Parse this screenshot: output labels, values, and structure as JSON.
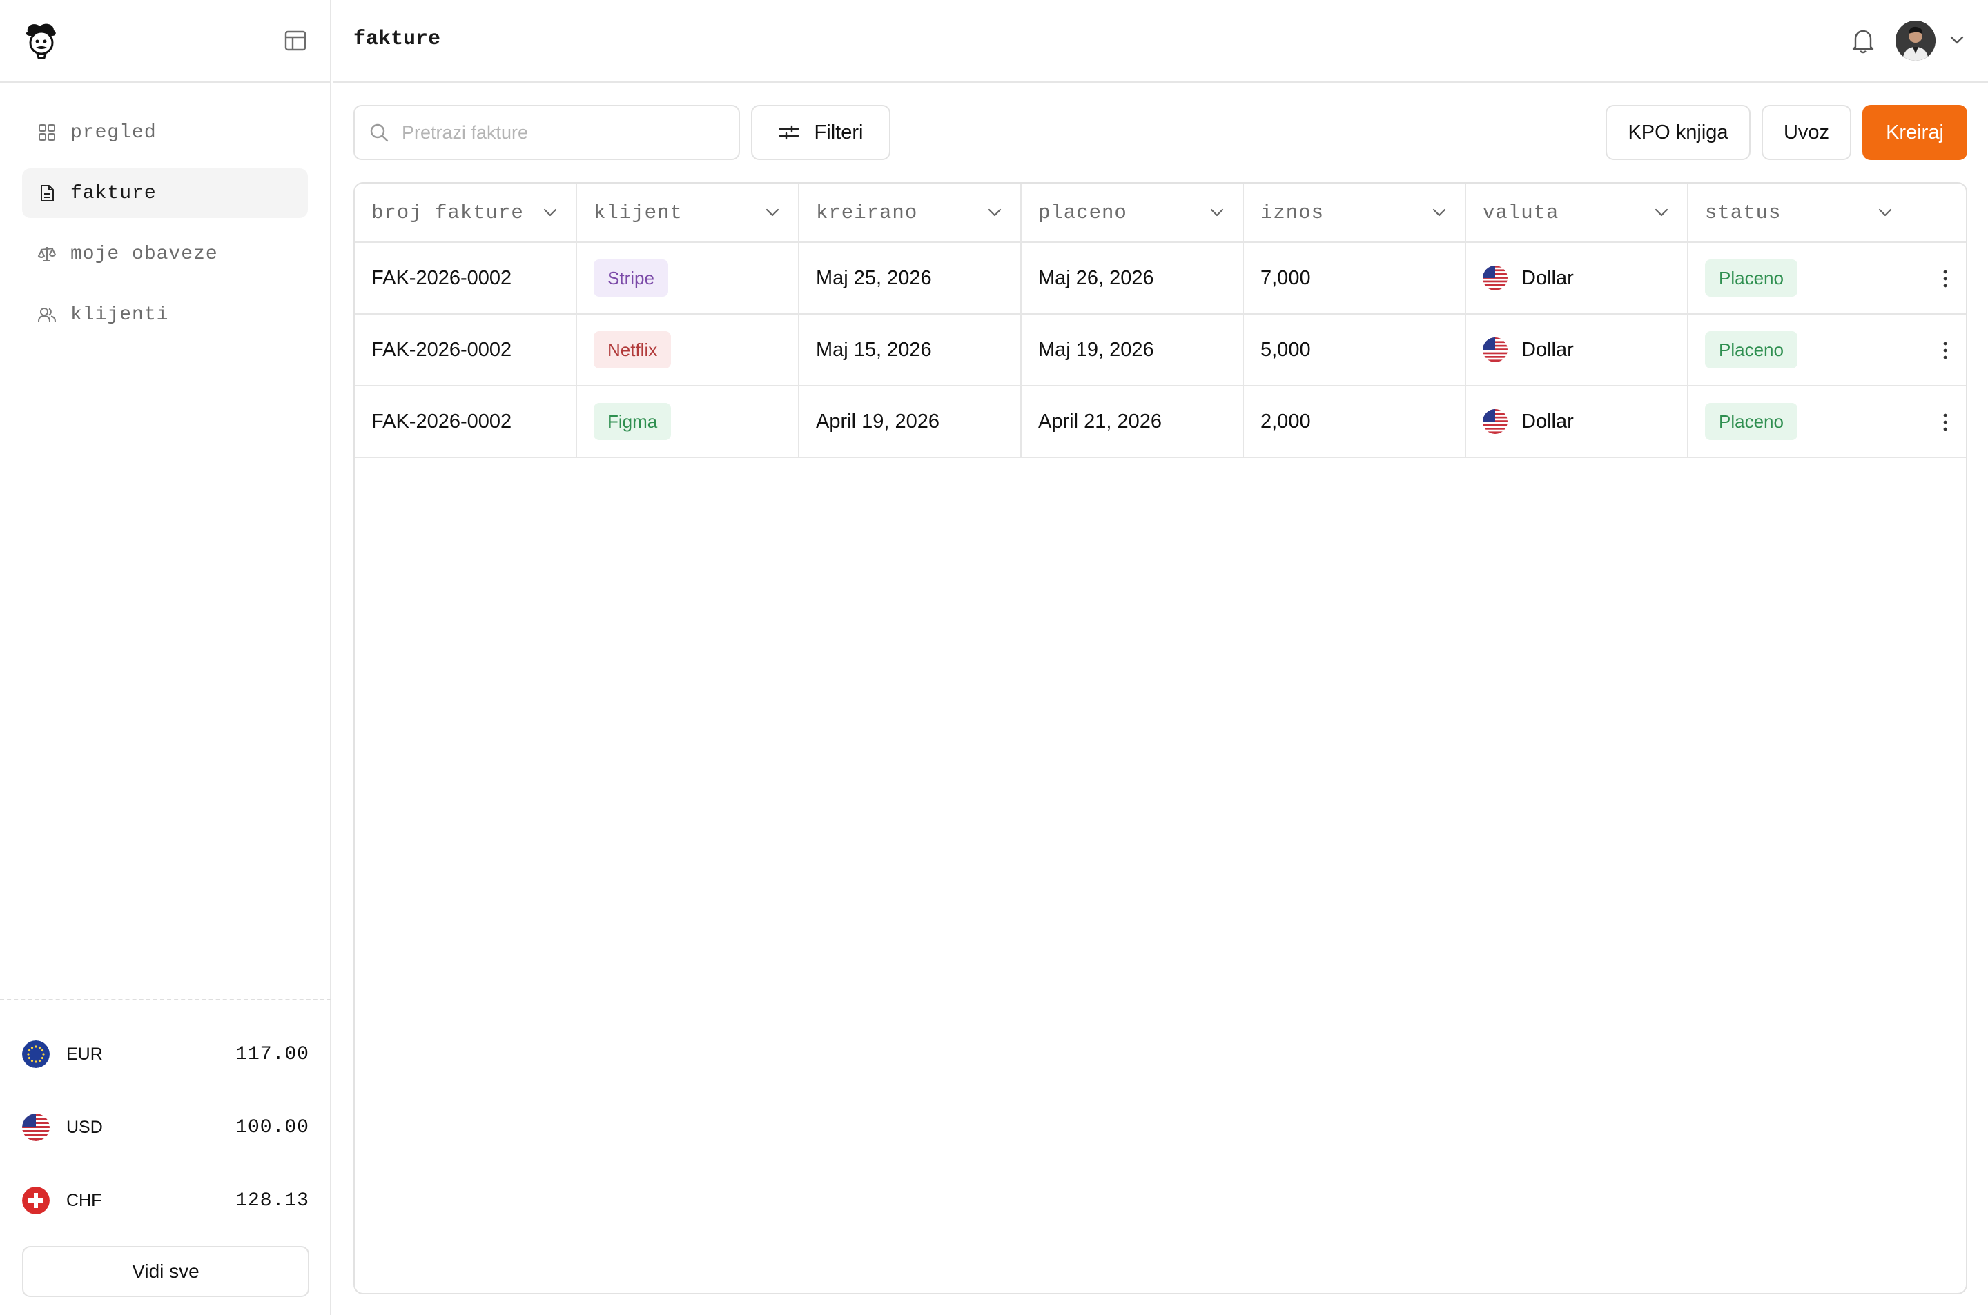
{
  "header": {
    "title": "fakture"
  },
  "sidebar": {
    "nav": [
      {
        "label": "pregled",
        "icon": "grid-icon"
      },
      {
        "label": "fakture",
        "icon": "document-icon",
        "active": true
      },
      {
        "label": "moje obaveze",
        "icon": "scale-icon"
      },
      {
        "label": "klijenti",
        "icon": "users-icon"
      }
    ],
    "balances": [
      {
        "code": "EUR",
        "amount": "117.00",
        "flag": "eu-flag-icon"
      },
      {
        "code": "USD",
        "amount": "100.00",
        "flag": "us-flag-icon"
      },
      {
        "code": "CHF",
        "amount": "128.13",
        "flag": "swiss-flag-icon"
      }
    ],
    "see_all": "Vidi sve"
  },
  "toolbar": {
    "search_placeholder": "Pretrazi fakture",
    "filters": "Filteri",
    "kpo": "KPO knjiga",
    "import": "Uvoz",
    "create": "Kreiraj"
  },
  "table": {
    "columns": [
      "broj fakture",
      "klijent",
      "kreirano",
      "placeno",
      "iznos",
      "valuta",
      "status"
    ],
    "rows": [
      {
        "number": "FAK-2026-0002",
        "client": "Stripe",
        "client_color": "purple",
        "created": "Maj 25, 2026",
        "paid": "Maj 26, 2026",
        "amount": "7,000",
        "currency": "Dollar",
        "status": "Placeno"
      },
      {
        "number": "FAK-2026-0002",
        "client": "Netflix",
        "client_color": "red",
        "created": "Maj 15, 2026",
        "paid": "Maj 19, 2026",
        "amount": "5,000",
        "currency": "Dollar",
        "status": "Placeno"
      },
      {
        "number": "FAK-2026-0002",
        "client": "Figma",
        "client_color": "green",
        "created": "April 19, 2026",
        "paid": "April 21, 2026",
        "amount": "2,000",
        "currency": "Dollar",
        "status": "Placeno"
      }
    ]
  },
  "colors": {
    "accent": "#f26b10",
    "border": "#e2e2e2",
    "muted_text": "#6c6c6c"
  }
}
